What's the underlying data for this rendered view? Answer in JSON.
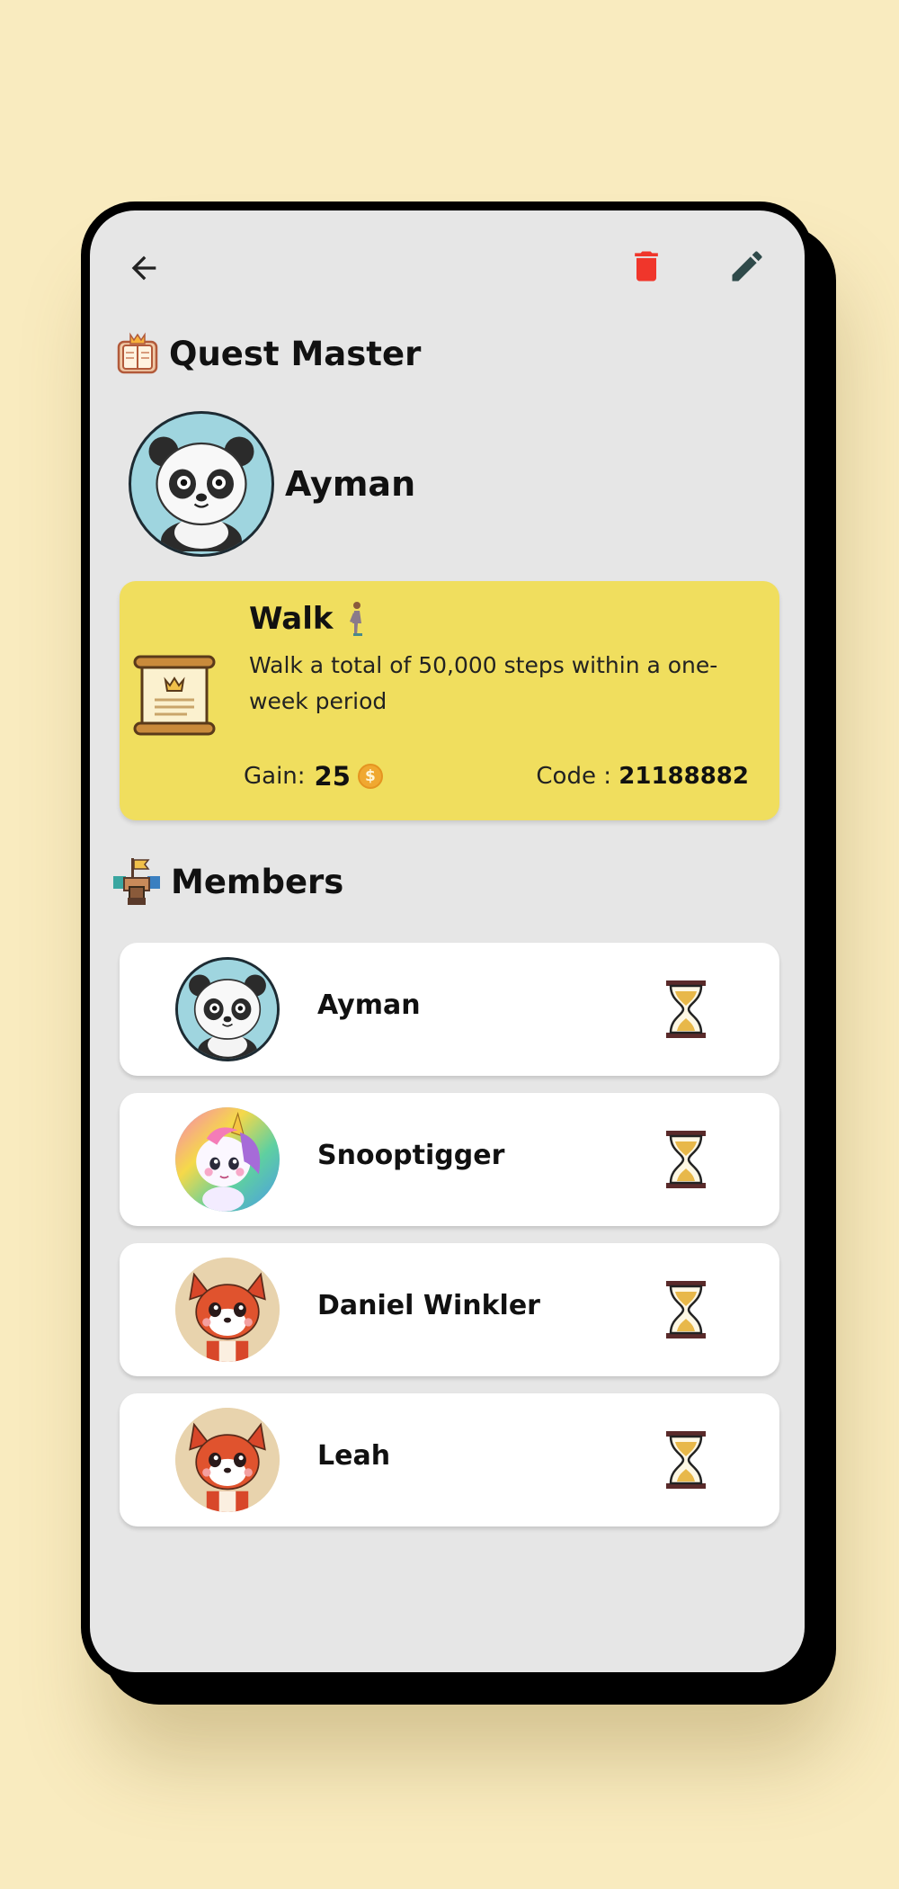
{
  "header": {
    "back_icon": "arrow-left-icon",
    "delete_icon": "trash-icon",
    "delete_color": "#f0362b",
    "edit_icon": "pencil-icon"
  },
  "quest_master": {
    "title": "Quest Master",
    "icon": "open-book-icon",
    "name": "Ayman",
    "avatar": "panda-avatar"
  },
  "quest": {
    "title": "Walk",
    "title_icon": "person-walking-icon",
    "description": "Walk a total of 50,000 steps within a one-week period",
    "gain_label": "Gain:",
    "gain_value": "25",
    "gain_icon": "coin-icon",
    "code_label": "Code : ",
    "code_value": "21188882",
    "card_icon": "scroll-icon",
    "card_color": "#f0de5e"
  },
  "members": {
    "title": "Members",
    "icon": "teamwork-hands-icon",
    "items": [
      {
        "name": "Ayman",
        "avatar": "panda-avatar",
        "status_icon": "hourglass-icon"
      },
      {
        "name": "Snooptigger",
        "avatar": "unicorn-avatar",
        "status_icon": "hourglass-icon"
      },
      {
        "name": "Daniel Winkler",
        "avatar": "red-panda-avatar",
        "status_icon": "hourglass-icon"
      },
      {
        "name": "Leah",
        "avatar": "red-panda-avatar",
        "status_icon": "hourglass-icon"
      }
    ]
  }
}
